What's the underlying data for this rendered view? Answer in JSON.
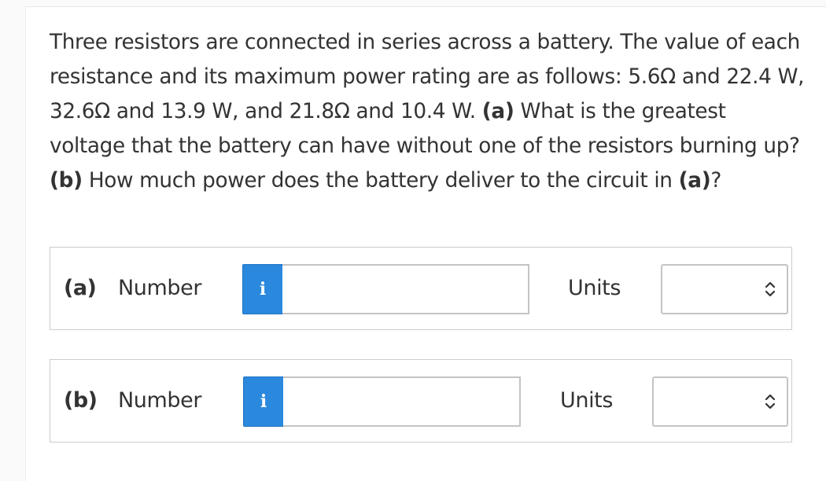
{
  "question": {
    "seg1": "Three resistors are connected in series across a battery. The value of each resistance and its maximum power rating are as follows: 5.6Ω and 22.4 W, 32.6Ω and 13.9 W, and 21.8Ω and 10.4 W. ",
    "part_a_tag": "(a)",
    "seg2": " What is the greatest voltage that the battery can have without one of the resistors burning up? ",
    "part_b_tag": "(b)",
    "seg3": " How much power does the battery deliver to the circuit in ",
    "part_a_ref": "(a)",
    "seg4": "?"
  },
  "answers": [
    {
      "part": "(a)",
      "number_label": "Number",
      "info_icon": "i",
      "number_value": "",
      "units_label": "Units",
      "units_selected": ""
    },
    {
      "part": "(b)",
      "number_label": "Number",
      "info_icon": "i",
      "number_value": "",
      "units_label": "Units",
      "units_selected": ""
    }
  ],
  "colors": {
    "info_button": "#2a88dd",
    "text": "#333333",
    "border": "#cccccc"
  }
}
